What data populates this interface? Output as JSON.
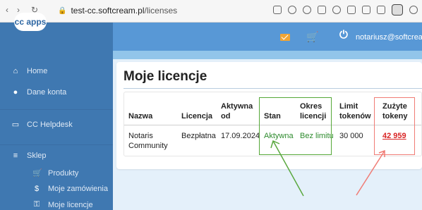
{
  "browser": {
    "url_host": "test-cc.softcream.pl",
    "url_path": "/licenses"
  },
  "sidebar": {
    "logo": "cc apps",
    "items": [
      {
        "label": "Home"
      },
      {
        "label": "Dane konta"
      },
      {
        "label": "CC Helpdesk"
      },
      {
        "label": "Sklep"
      },
      {
        "label": "Produkty"
      },
      {
        "label": "Moje zamówienia"
      },
      {
        "label": "Moje licencje"
      }
    ]
  },
  "header": {
    "email": "notariusz@softcream.pl"
  },
  "page": {
    "title": "Moje licencje"
  },
  "table": {
    "headers": [
      "Nazwa",
      "Licencja",
      "Aktywna od",
      "Stan",
      "Okres licencji",
      "Limit tokenów",
      "Zużyte tokeny"
    ],
    "header_lines": {
      "aktywna": [
        "Aktywna",
        "od"
      ],
      "okres": [
        "Okres",
        "licencji"
      ],
      "limit": [
        "Limit",
        "tokenów"
      ],
      "zuzyte": [
        "Zużyte",
        "tokeny"
      ]
    },
    "row": {
      "nazwa": [
        "Notaris",
        "Community"
      ],
      "licencja": "Bezpłatna",
      "aktywna_od": "17.09.2024",
      "stan": "Aktywna",
      "okres": "Bez limitu",
      "limit": "30 000",
      "zuzyte": "42 959"
    }
  },
  "colors": {
    "sidebar": "#3f78b1",
    "header": "#5898d6",
    "highlight_green": "#55a838",
    "highlight_red": "#f07c75"
  }
}
